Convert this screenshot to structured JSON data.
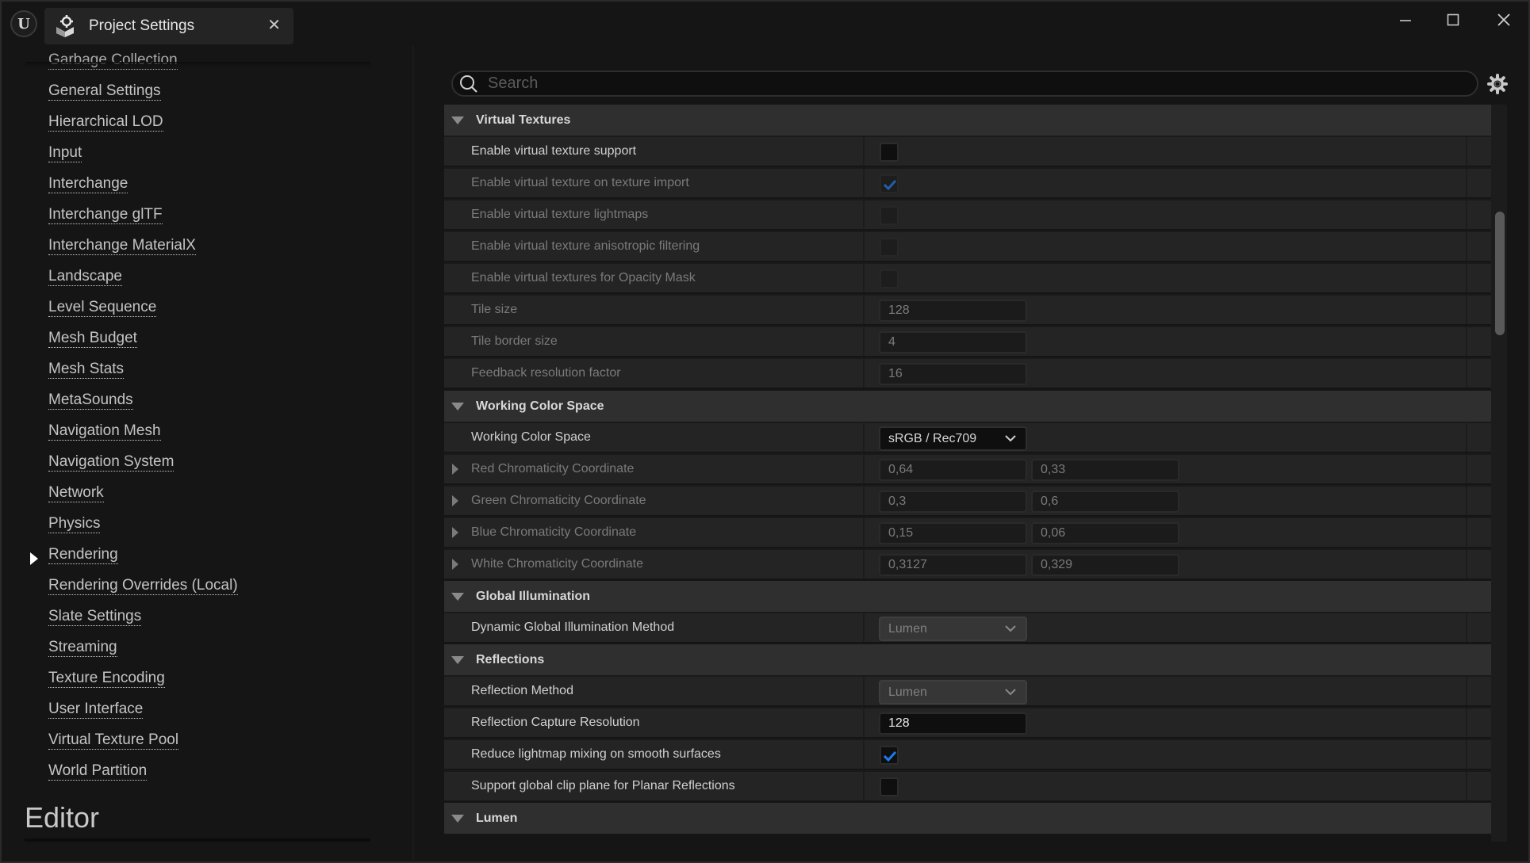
{
  "window": {
    "tab_title": "Project Settings",
    "tab_icon": "project-settings-icon",
    "app_logo": "unreal-engine-logo",
    "controls": [
      "minimize",
      "maximize",
      "close"
    ]
  },
  "nav": {
    "items": [
      {
        "label": "Garbage Collection"
      },
      {
        "label": "General Settings"
      },
      {
        "label": "Hierarchical LOD"
      },
      {
        "label": "Input"
      },
      {
        "label": "Interchange"
      },
      {
        "label": "Interchange glTF"
      },
      {
        "label": "Interchange MaterialX"
      },
      {
        "label": "Landscape"
      },
      {
        "label": "Level Sequence"
      },
      {
        "label": "Mesh Budget"
      },
      {
        "label": "Mesh Stats"
      },
      {
        "label": "MetaSounds"
      },
      {
        "label": "Navigation Mesh"
      },
      {
        "label": "Navigation System"
      },
      {
        "label": "Network"
      },
      {
        "label": "Physics"
      },
      {
        "label": "Rendering",
        "selected": true
      },
      {
        "label": "Rendering Overrides (Local)"
      },
      {
        "label": "Slate Settings"
      },
      {
        "label": "Streaming"
      },
      {
        "label": "Texture Encoding"
      },
      {
        "label": "User Interface"
      },
      {
        "label": "Virtual Texture Pool"
      },
      {
        "label": "World Partition"
      }
    ],
    "section_heading": "Editor"
  },
  "search": {
    "placeholder": "Search",
    "value": ""
  },
  "details": {
    "virtual_textures": {
      "title": "Virtual Textures",
      "rows": [
        {
          "label": "Enable virtual texture support",
          "type": "checkbox",
          "checked": false,
          "enabled": true
        },
        {
          "label": "Enable virtual texture on texture import",
          "type": "checkbox",
          "checked": true,
          "enabled": false
        },
        {
          "label": "Enable virtual texture lightmaps",
          "type": "checkbox",
          "checked": false,
          "enabled": false
        },
        {
          "label": "Enable virtual texture anisotropic filtering",
          "type": "checkbox",
          "checked": false,
          "enabled": false
        },
        {
          "label": "Enable virtual textures for Opacity Mask",
          "type": "checkbox",
          "checked": false,
          "enabled": false
        },
        {
          "label": "Tile size",
          "type": "number",
          "value": "128",
          "enabled": false
        },
        {
          "label": "Tile border size",
          "type": "number",
          "value": "4",
          "enabled": false
        },
        {
          "label": "Feedback resolution factor",
          "type": "number",
          "value": "16",
          "enabled": false
        }
      ]
    },
    "working_color_space": {
      "title": "Working Color Space",
      "rows": [
        {
          "label": "Working Color Space",
          "type": "combo",
          "value": "sRGB / Rec709",
          "enabled": true
        },
        {
          "label": "Red Chromaticity Coordinate",
          "type": "vec2",
          "x": "0,64",
          "y": "0,33",
          "enabled": false
        },
        {
          "label": "Green Chromaticity Coordinate",
          "type": "vec2",
          "x": "0,3",
          "y": "0,6",
          "enabled": false
        },
        {
          "label": "Blue Chromaticity Coordinate",
          "type": "vec2",
          "x": "0,15",
          "y": "0,06",
          "enabled": false
        },
        {
          "label": "White Chromaticity Coordinate",
          "type": "vec2",
          "x": "0,3127",
          "y": "0,329",
          "enabled": false
        }
      ]
    },
    "global_illumination": {
      "title": "Global Illumination",
      "rows": [
        {
          "label": "Dynamic Global Illumination Method",
          "type": "combo",
          "value": "Lumen",
          "enabled": false
        }
      ]
    },
    "reflections": {
      "title": "Reflections",
      "rows": [
        {
          "label": "Reflection Method",
          "type": "combo",
          "value": "Lumen",
          "enabled": false
        },
        {
          "label": "Reflection Capture Resolution",
          "type": "number",
          "value": "128",
          "enabled": true
        },
        {
          "label": "Reduce lightmap mixing on smooth surfaces",
          "type": "checkbox",
          "checked": true,
          "enabled": true
        },
        {
          "label": "Support global clip plane for Planar Reflections",
          "type": "checkbox",
          "checked": false,
          "enabled": true
        }
      ]
    },
    "lumen": {
      "title": "Lumen"
    }
  },
  "colors": {
    "accent_check": "#1a7cf0",
    "dim_check": "#1f5fa8",
    "background": "#151515",
    "category_bg": "#2f2f2f",
    "row_bg": "#242424"
  }
}
